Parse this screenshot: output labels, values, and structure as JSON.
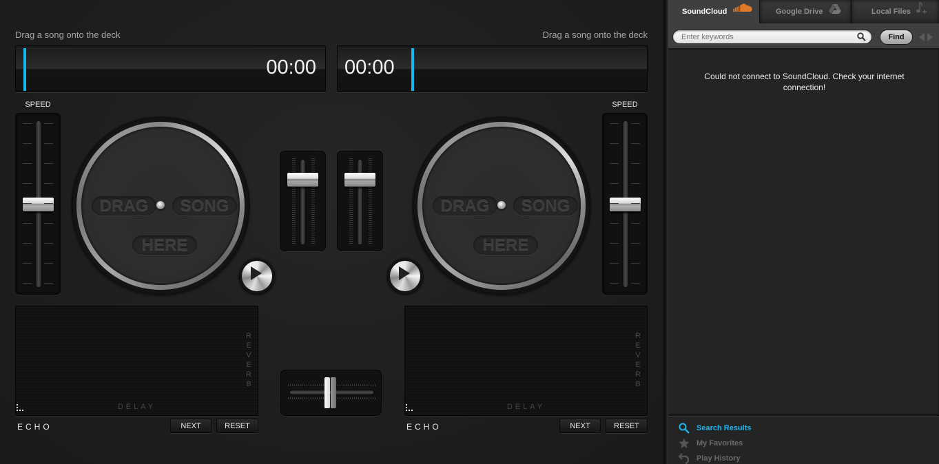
{
  "decks": {
    "left": {
      "hint": "Drag a song onto the deck",
      "time": "00:00",
      "speed_label": "SPEED",
      "platter": {
        "word1": "DRAG",
        "word2": "SONG",
        "word3": "HERE"
      },
      "fx": {
        "x_label": "DELAY",
        "y_label": "REVERB",
        "name": "ECHO"
      },
      "next_label": "NEXT",
      "reset_label": "RESET",
      "playhead_position": 0,
      "speed_value": 0.5,
      "volume_value": 0.85
    },
    "right": {
      "hint": "Drag a song onto the deck",
      "time": "00:00",
      "speed_label": "SPEED",
      "platter": {
        "word1": "DRAG",
        "word2": "SONG",
        "word3": "HERE"
      },
      "fx": {
        "x_label": "DELAY",
        "y_label": "REVERB",
        "name": "ECHO"
      },
      "next_label": "NEXT",
      "reset_label": "RESET",
      "playhead_position": 0,
      "speed_value": 0.5,
      "volume_value": 0.85
    }
  },
  "crossfader": {
    "value": 0.5
  },
  "sidebar": {
    "tabs": [
      {
        "label": "SoundCloud",
        "icon": "cloud-icon",
        "active": true
      },
      {
        "label": "Google Drive",
        "icon": "drive-icon",
        "active": false
      },
      {
        "label": "Local Files",
        "icon": "music-note-icon",
        "active": false
      }
    ],
    "search": {
      "placeholder": "Enter keywords",
      "value": "",
      "find_label": "Find"
    },
    "message": "Could not connect to SoundCloud. Check your internet connection!",
    "nav": [
      {
        "label": "Search Results",
        "icon": "search-icon",
        "active": true
      },
      {
        "label": "My Favorites",
        "icon": "star-icon",
        "active": false
      },
      {
        "label": "Play History",
        "icon": "history-icon",
        "active": false
      }
    ]
  },
  "colors": {
    "accent": "#16b6ee",
    "soundcloud_orange": "#e07a2a",
    "nav_active": "#1fb5ec"
  }
}
